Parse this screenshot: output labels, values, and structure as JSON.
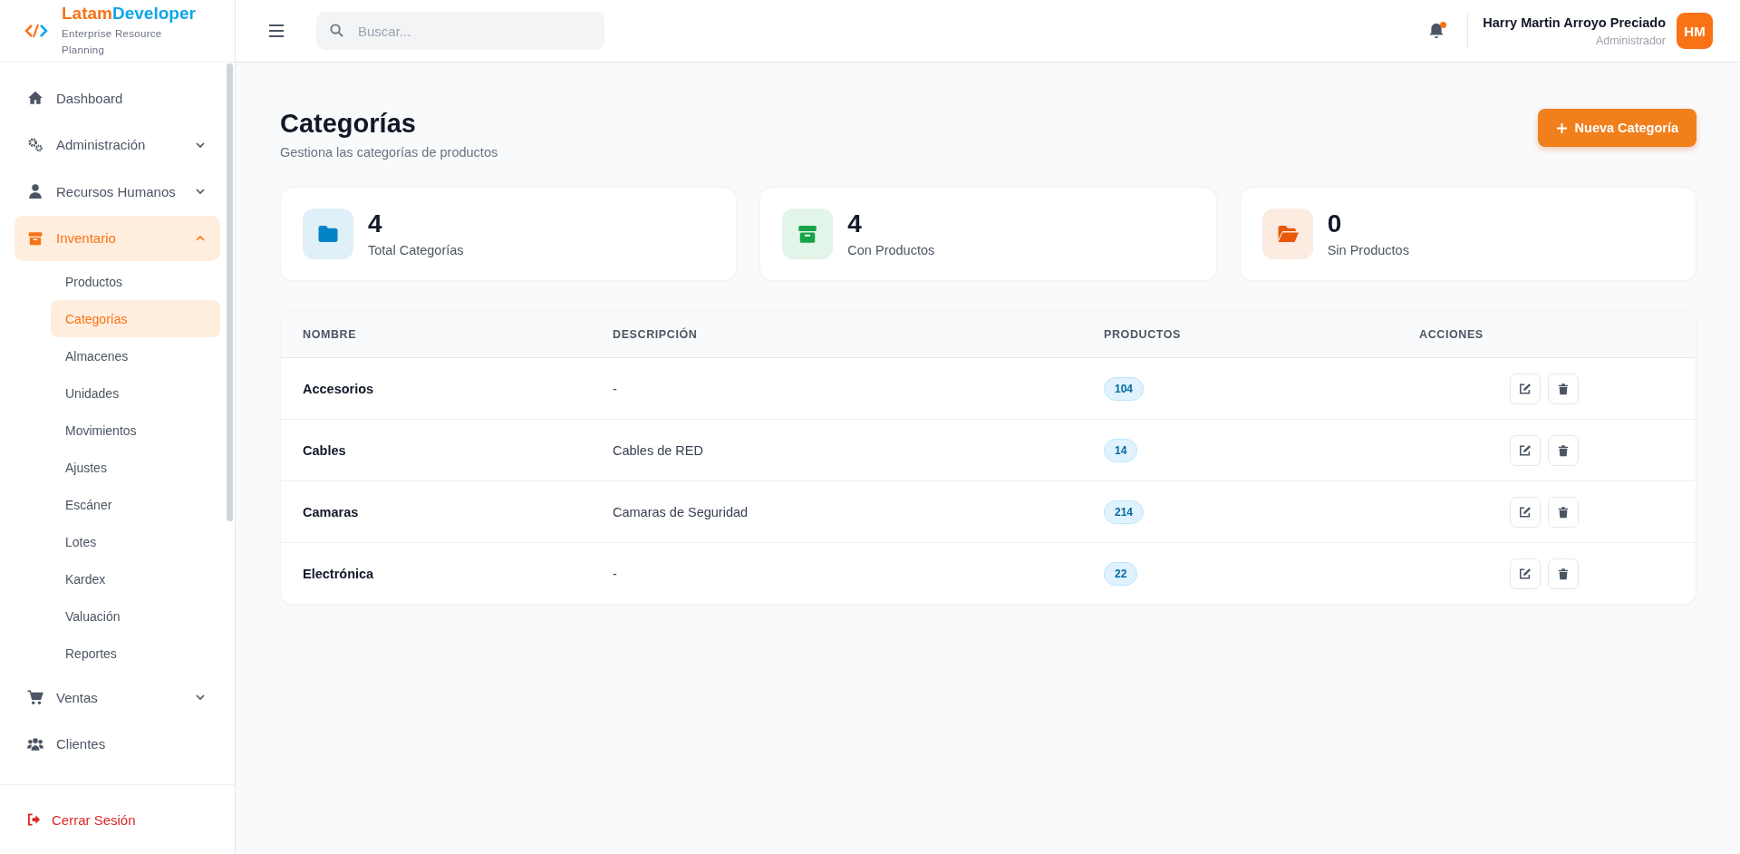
{
  "brand": {
    "name_first": "Latam",
    "name_second": "Developer",
    "subtitle": "Enterprise Resource Planning"
  },
  "search": {
    "placeholder": "Buscar..."
  },
  "user": {
    "name": "Harry Martin Arroyo Preciado",
    "role": "Administrador",
    "initials": "HM",
    "has_notification": true
  },
  "sidebar": {
    "items": [
      {
        "label": "Dashboard",
        "kind": "home",
        "selected": false
      },
      {
        "label": "Administración",
        "kind": "gears",
        "selected": false,
        "expanded": false
      },
      {
        "label": "Recursos Humanos",
        "kind": "user",
        "selected": false,
        "expanded": false
      },
      {
        "label": "Inventario",
        "kind": "box",
        "selected": true,
        "expanded": true,
        "children": [
          {
            "label": "Productos",
            "selected": false
          },
          {
            "label": "Categorías",
            "selected": true
          },
          {
            "label": "Almacenes",
            "selected": false
          },
          {
            "label": "Unidades",
            "selected": false
          },
          {
            "label": "Movimientos",
            "selected": false
          },
          {
            "label": "Ajustes",
            "selected": false
          },
          {
            "label": "Escáner",
            "selected": false
          },
          {
            "label": "Lotes",
            "selected": false
          },
          {
            "label": "Kardex",
            "selected": false
          },
          {
            "label": "Valuación",
            "selected": false
          },
          {
            "label": "Reportes",
            "selected": false
          }
        ]
      },
      {
        "label": "Ventas",
        "kind": "cart",
        "selected": false,
        "expanded": false
      },
      {
        "label": "Clientes",
        "kind": "users",
        "selected": false
      }
    ],
    "logout": "Cerrar Sesión"
  },
  "page": {
    "title": "Categorías",
    "subtitle": "Gestiona las categorías de productos",
    "new_button": "Nueva Categoría"
  },
  "stats": [
    {
      "value": "4",
      "label": "Total Categorías",
      "kind": "folder",
      "color": "#0284c7"
    },
    {
      "value": "4",
      "label": "Con Productos",
      "kind": "box",
      "color": "#16a34a"
    },
    {
      "value": "0",
      "label": "Sin Productos",
      "kind": "folder-open",
      "color": "#ea580c"
    }
  ],
  "table": {
    "columns": [
      "NOMBRE",
      "DESCRIPCIÓN",
      "PRODUCTOS",
      "ACCIONES"
    ],
    "rows": [
      {
        "name": "Accesorios",
        "description": "-",
        "products": "104"
      },
      {
        "name": "Cables",
        "description": "Cables de RED",
        "products": "14"
      },
      {
        "name": "Camaras",
        "description": "Camaras de Seguridad",
        "products": "214"
      },
      {
        "name": "Electrónica",
        "description": "-",
        "products": "22"
      }
    ]
  }
}
